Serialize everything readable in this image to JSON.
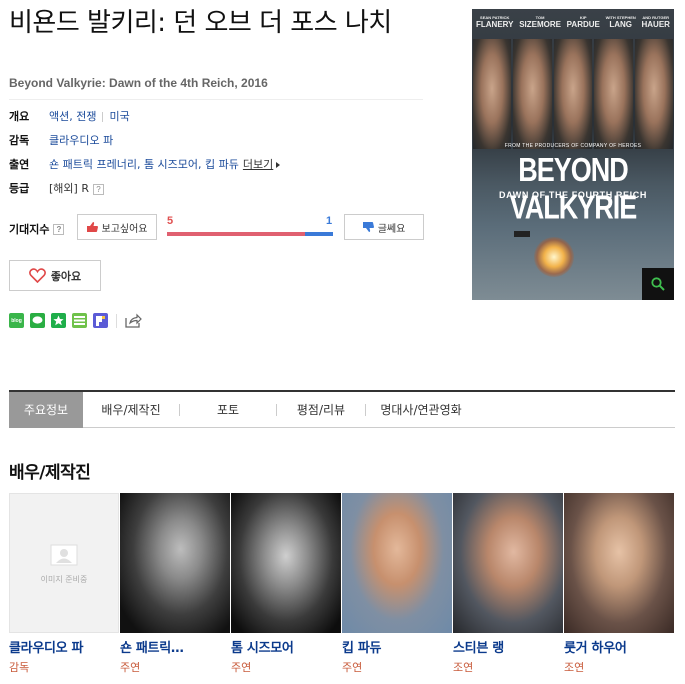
{
  "movie": {
    "title": "비욘드 발키리: 던 오브 더 포스 나치",
    "subtitle": "Beyond Valkyrie: Dawn of the 4th Reich, 2016"
  },
  "info": {
    "overview_label": "개요",
    "genres": "액션, 전쟁",
    "country": "미국",
    "director_label": "감독",
    "director": "클라우디오 파",
    "cast_label": "출연",
    "cast": "숀 패트릭 프레너리, 톰 시즈모어, 킵 파듀",
    "more": "더보기",
    "rating_label": "등급",
    "rating": "[해외] R",
    "help": "?"
  },
  "vote": {
    "expect_label": "기대지수",
    "want_label": "보고싶어요",
    "meh_label": "글쎄요",
    "want_count": "5",
    "meh_count": "1",
    "want_ratio": 0.83
  },
  "like_label": "좋아요",
  "share": {
    "icons": [
      "blog-icon",
      "talk-icon",
      "star-icon",
      "memo-icon",
      "pocket-icon",
      "share-icon"
    ],
    "blog_text": "blog"
  },
  "poster": {
    "actors": [
      {
        "first": "SEAN PATRICK",
        "last": "FLANERY"
      },
      {
        "first": "TOM",
        "last": "SIZEMORE"
      },
      {
        "first": "KIP",
        "last": "PARDUE"
      },
      {
        "first": "WITH STEPHEN",
        "last": "LANG"
      },
      {
        "first": "AND RUTGER",
        "last": "HAUER"
      }
    ],
    "from_line": "FROM THE PRODUCERS OF COMPANY OF HEROES",
    "title_big": "BEYOND VALKYRIE",
    "title_small": "DAWN OF THE FOURTH REICH"
  },
  "tabs": [
    "주요정보",
    "배우/제작진",
    "포토",
    "평점/리뷰",
    "명대사/연관영화"
  ],
  "cast_section_title": "배우/제작진",
  "cast_list": [
    {
      "name": "클라우디오 파",
      "role": "감독",
      "placeholder": "이미지 준비중"
    },
    {
      "name": "숀 패트릭…",
      "role": "주연"
    },
    {
      "name": "톰 시즈모어",
      "role": "주연"
    },
    {
      "name": "킵 파듀",
      "role": "주연"
    },
    {
      "name": "스티븐 랭",
      "role": "조연"
    },
    {
      "name": "룻거 하우어",
      "role": "조연"
    }
  ]
}
